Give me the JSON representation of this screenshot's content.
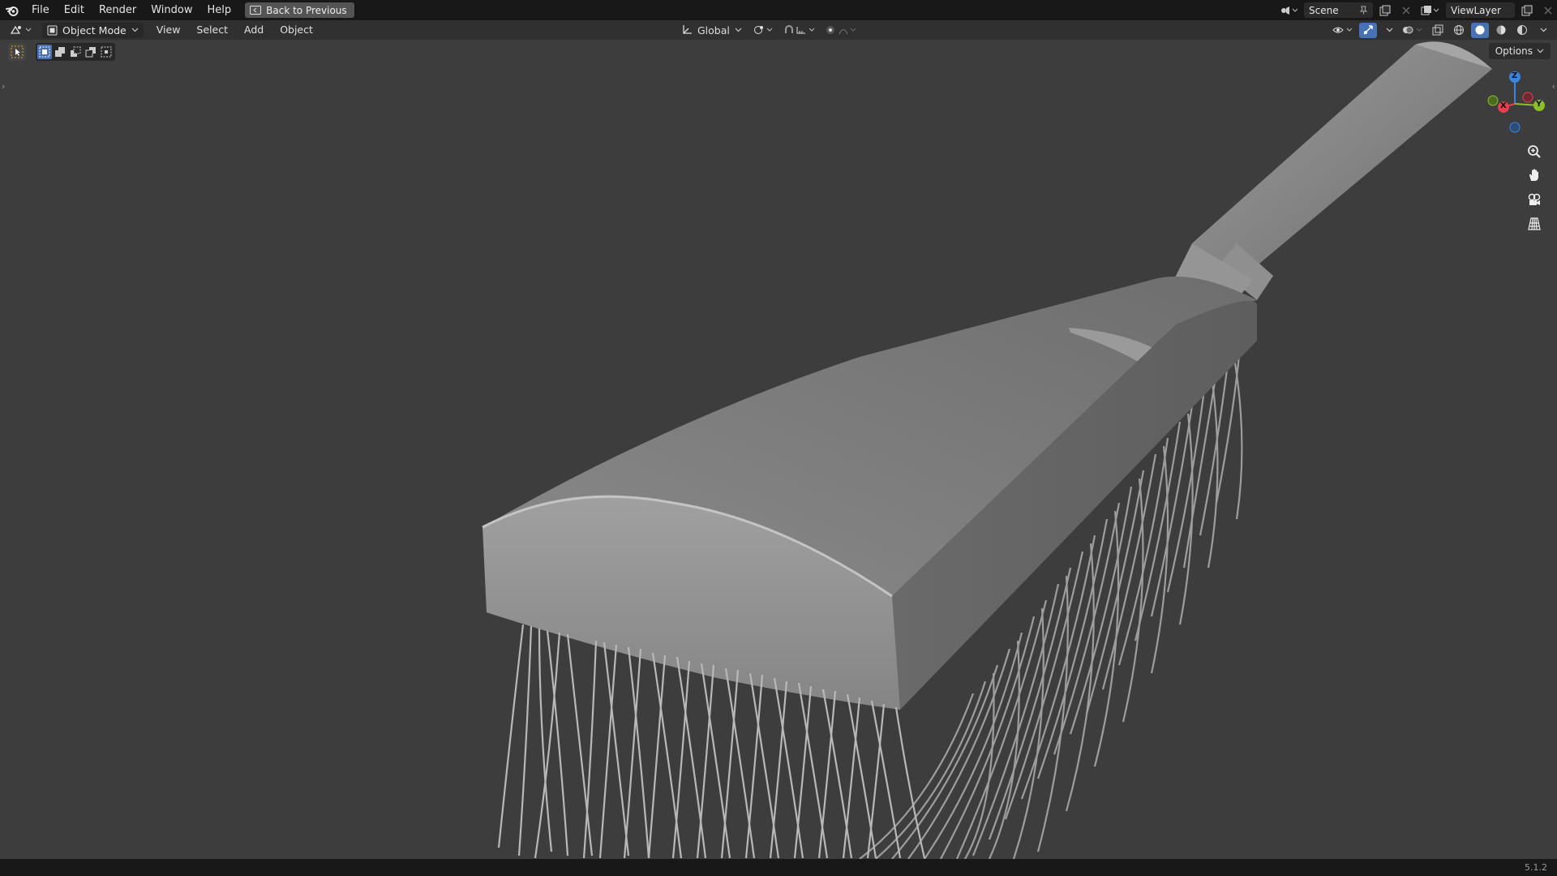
{
  "topbar": {
    "menu": [
      "File",
      "Edit",
      "Render",
      "Window",
      "Help"
    ],
    "back_button": "Back to Previous",
    "scene": "Scene",
    "view_layer": "ViewLayer"
  },
  "header": {
    "mode": "Object Mode",
    "menu": [
      "View",
      "Select",
      "Add",
      "Object"
    ],
    "transform_orientation": "Global"
  },
  "viewport": {
    "options_label": "Options",
    "gizmo": {
      "z": "Z",
      "x": "X",
      "y": "Y"
    }
  },
  "statusbar": {
    "version": "5.1.2"
  },
  "colors": {
    "accent": "#4772b3",
    "axis_x": "#e5404f",
    "axis_y": "#8bbf2a",
    "axis_z": "#3b84e0"
  }
}
